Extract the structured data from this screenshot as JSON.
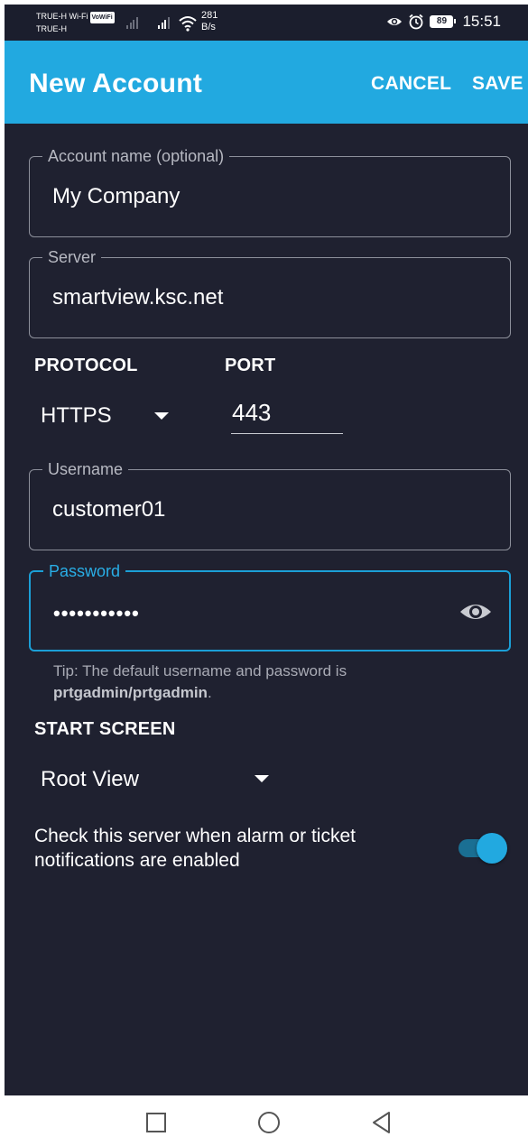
{
  "status_bar": {
    "carrier_1": "TRUE-H Wi-Fi",
    "vowifi_badge": "VoWiFi",
    "carrier_2": "TRUE-H",
    "network_speed_value": "281",
    "network_speed_unit": "B/s",
    "battery_level": "89",
    "time": "15:51",
    "icons": [
      "signal-icon",
      "wifi-icon",
      "eye-icon",
      "alarm-icon",
      "battery-icon"
    ]
  },
  "app_bar": {
    "title": "New Account",
    "cancel_label": "CANCEL",
    "save_label": "SAVE",
    "color": "#22a9e0"
  },
  "form": {
    "account_name": {
      "label": "Account name (optional)",
      "value": "My Company"
    },
    "server": {
      "label": "Server",
      "value": "smartview.ksc.net"
    },
    "protocol": {
      "label": "PROTOCOL",
      "value": "HTTPS"
    },
    "port": {
      "label": "PORT",
      "value": "443"
    },
    "username": {
      "label": "Username",
      "value": "customer01"
    },
    "password": {
      "label": "Password",
      "masked_value": "•••••••••••",
      "reveal_icon": "eye-icon"
    },
    "tip": {
      "prefix": "Tip: The default username and password is",
      "credentials": "prtgadmin/prtgadmin",
      "suffix": "."
    },
    "start_screen": {
      "label": "START SCREEN",
      "value": "Root View"
    },
    "check_server": {
      "label": "Check this server when alarm or ticket notifications are enabled",
      "enabled": true
    }
  },
  "nav_bar": {
    "icons": [
      "back-icon",
      "home-icon",
      "recents-icon"
    ]
  },
  "colors": {
    "accent": "#22a9e0",
    "background": "#1f2130",
    "focus_border": "#1b9fd6"
  }
}
